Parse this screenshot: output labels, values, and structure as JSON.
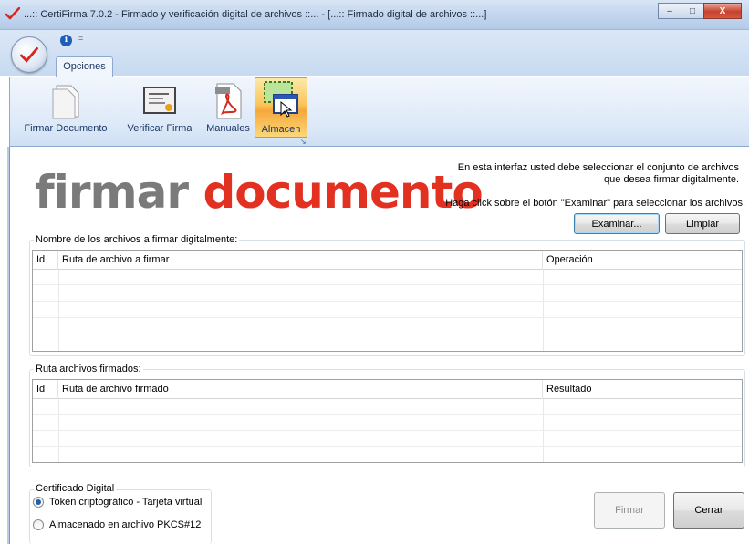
{
  "window": {
    "title": "...:: CertiFirma 7.0.2 - Firmado y verificación digital de archivos ::... - [...:: Firmado digital de archivos ::...]",
    "minimize_glyph": "–",
    "maximize_glyph": "□",
    "close_glyph": "X"
  },
  "quick_access": {
    "info_glyph": "i",
    "dropdown_glyph": "="
  },
  "ribbon": {
    "tab_label": "Opciones",
    "buttons": [
      {
        "label": "Firmar Documento",
        "icon": "document-icon"
      },
      {
        "label": "Verificar Firma",
        "icon": "certificate-icon"
      },
      {
        "label": "Manuales",
        "icon": "pdf-icon"
      },
      {
        "label": "Almacen",
        "icon": "storage-icon"
      }
    ],
    "launcher_glyph": "↘"
  },
  "main": {
    "title_part1": "firmar",
    "title_part2": "documento",
    "instruction_line1": "En esta interfaz usted debe seleccionar el conjunto de archivos",
    "instruction_line2": "que  desea firmar digitalmente.",
    "instruction_line3": "Haga click sobre el botón \"Examinar\" para seleccionar los archivos.",
    "examinar_label": "Examinar...",
    "limpiar_label": "Limpiar"
  },
  "files_to_sign": {
    "group_label": "Nombre de los archivos a firmar digitalmente:",
    "columns": [
      "Id",
      "Ruta de archivo a firmar",
      "Operación"
    ],
    "rows": []
  },
  "signed_files": {
    "group_label": "Ruta archivos firmados:",
    "columns": [
      "Id",
      "Ruta de archivo firmado",
      "Resultado"
    ],
    "rows": []
  },
  "certificate": {
    "group_label": "Certificado Digital",
    "option_token": "Token criptográfico - Tarjeta virtual",
    "option_file": "Almacenado en archivo PKCS#12",
    "selected": "token"
  },
  "actions": {
    "firmar_label": "Firmar",
    "cerrar_label": "Cerrar"
  },
  "colors": {
    "title_gray": "#7a7a7a",
    "title_red": "#e23021",
    "ribbon_blue": "#c7daf1",
    "active_orange": "#f9c55a"
  }
}
